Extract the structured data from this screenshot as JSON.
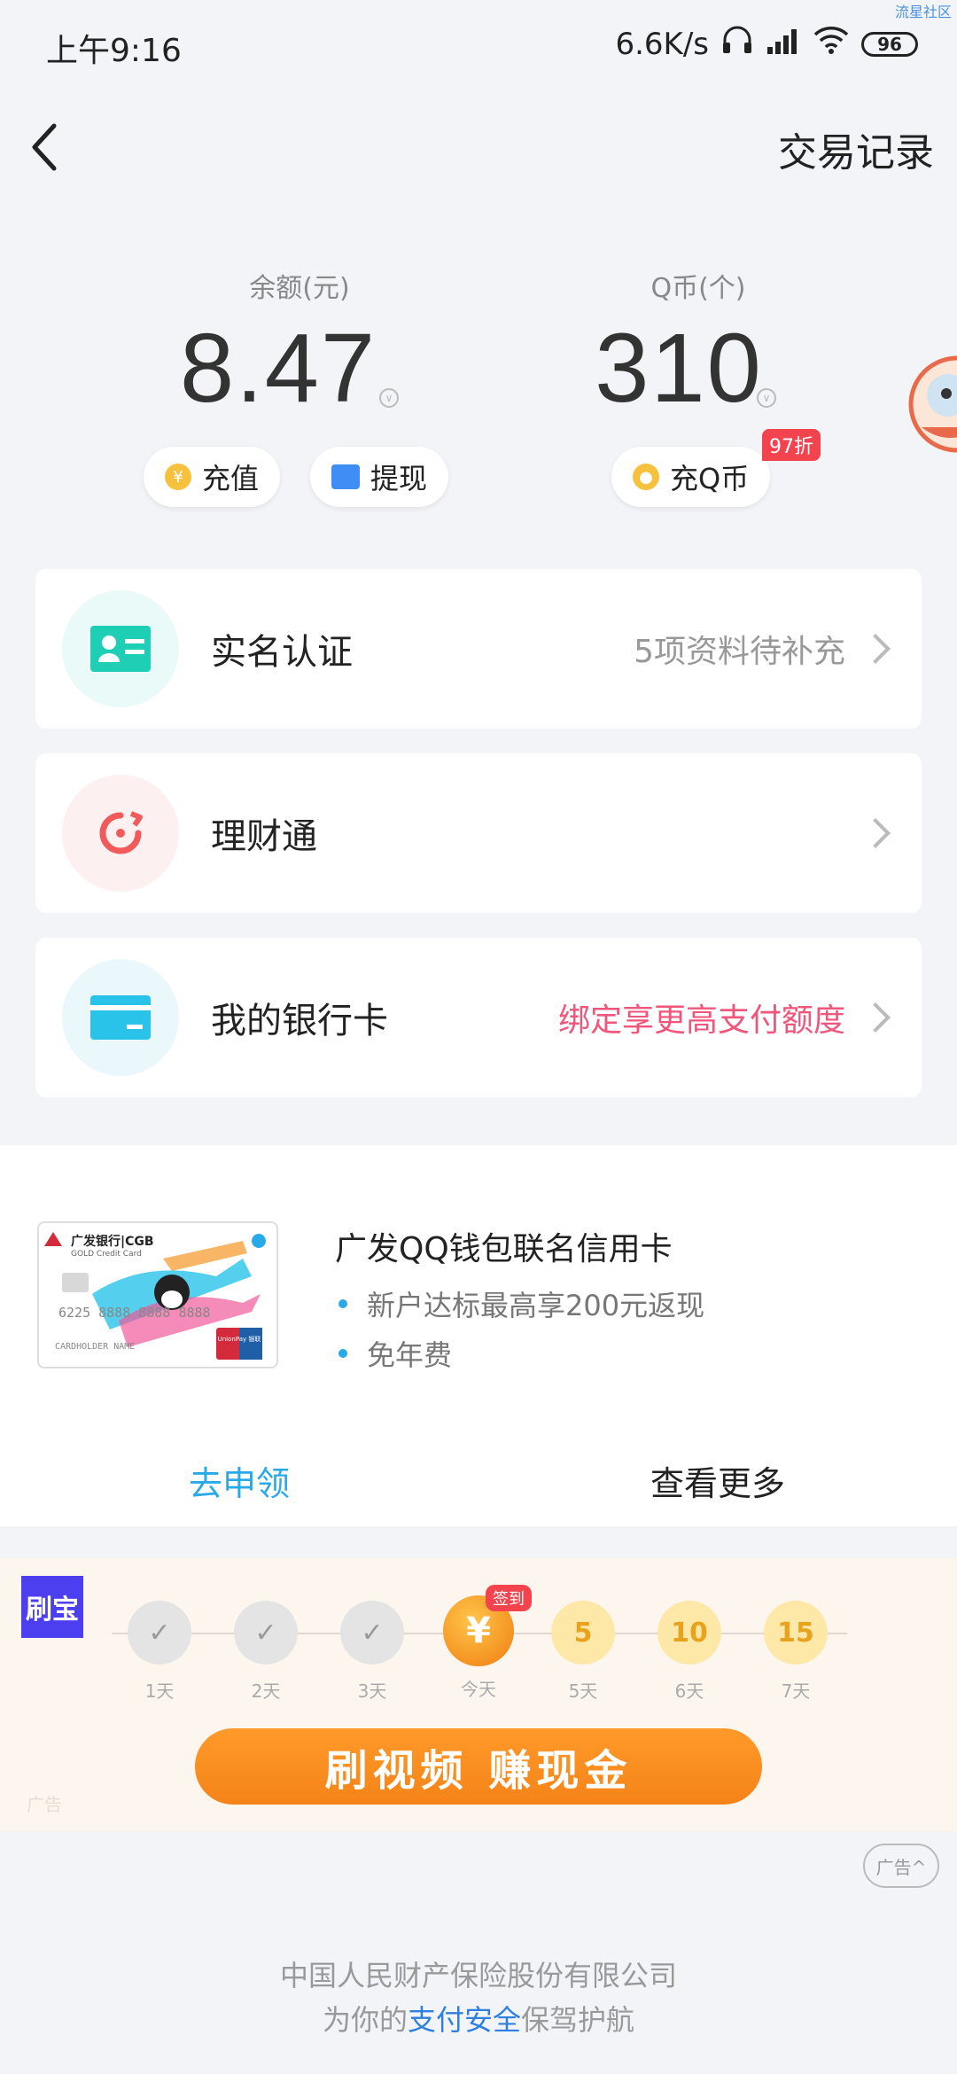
{
  "status_bar": {
    "time": "上午9:16",
    "network_speed": "6.6K/s",
    "battery": "96",
    "watermark": "流星社区"
  },
  "nav": {
    "title": "交易记录"
  },
  "balance": {
    "label": "余额(元)",
    "value": "8.47",
    "recharge_label": "充值",
    "withdraw_label": "提现"
  },
  "qcoin": {
    "label": "Q币(个)",
    "value": "310",
    "recharge_label": "充Q币",
    "discount_badge": "97折"
  },
  "cards": [
    {
      "title": "实名认证",
      "note": "5项资料待补充",
      "note_color": "#999999",
      "icon_bg": "#eafaf8",
      "icon_color": "#1fcfb5"
    },
    {
      "title": "理财通",
      "note": "",
      "note_color": "#999999",
      "icon_bg": "#fdf0f0",
      "icon_color": "#f05a5a"
    },
    {
      "title": "我的银行卡",
      "note": "绑定享更高支付额度",
      "note_color": "#f0557a",
      "icon_bg": "#eaf8fc",
      "icon_color": "#29c3ea"
    }
  ],
  "promo": {
    "card_bank": "广发银行|CGB",
    "card_sub": "GOLD Credit Card",
    "card_number": "6225 8888 8888 8888",
    "card_holder": "CARDHOLDER NAME",
    "card_network": "UnionPay 银联",
    "title": "广发QQ钱包联名信用卡",
    "bullets": [
      "新户达标最高享200元返现",
      "免年费"
    ],
    "apply_label": "去申领",
    "more_label": "查看更多",
    "apply_color": "#29a9e8"
  },
  "checkin": {
    "brand": "刷宝",
    "badge": "签到",
    "steps": [
      {
        "value": "✓",
        "day": "1天",
        "state": "done"
      },
      {
        "value": "✓",
        "day": "2天",
        "state": "done"
      },
      {
        "value": "✓",
        "day": "3天",
        "state": "done"
      },
      {
        "value": "¥",
        "day": "今天",
        "state": "today"
      },
      {
        "value": "5",
        "day": "5天",
        "state": "future"
      },
      {
        "value": "10",
        "day": "6天",
        "state": "future"
      },
      {
        "value": "15",
        "day": "7天",
        "state": "future"
      }
    ],
    "cta": "刷视频  赚现金",
    "ad_tag": "广告"
  },
  "ad_chip": "广告^",
  "footer": {
    "line1": "中国人民财产保险股份有限公司",
    "line2_prefix": "为你的",
    "line2_highlight": "支付安全",
    "line2_suffix": "保驾护航",
    "highlight_color": "#2f7fe0"
  }
}
